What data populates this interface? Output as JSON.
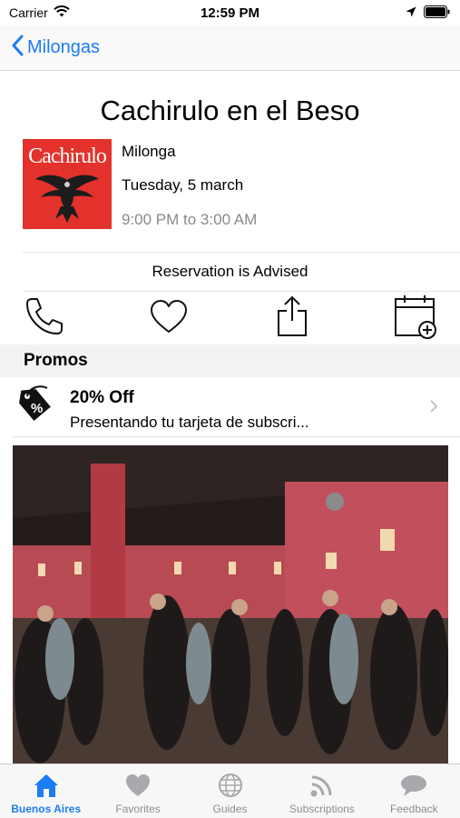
{
  "status_bar": {
    "carrier": "Carrier",
    "time": "12:59 PM"
  },
  "nav": {
    "back_label": "Milongas"
  },
  "event": {
    "title": "Cachirulo en el Beso",
    "logo_text": "Cachirulo",
    "type": "Milonga",
    "date": "Tuesday, 5 march",
    "time": "9:00 PM to 3:00 AM",
    "reservation": "Reservation is Advised"
  },
  "actions": [
    {
      "name": "call",
      "icon": "phone-icon"
    },
    {
      "name": "favorite",
      "icon": "heart-icon"
    },
    {
      "name": "share",
      "icon": "share-icon"
    },
    {
      "name": "add-to-calendar",
      "icon": "calendar-add-icon"
    }
  ],
  "promos": {
    "header": "Promos",
    "items": [
      {
        "title": "20% Off",
        "description": "Presentando tu tarjeta de subscri...",
        "icon": "percent-tag-icon"
      }
    ]
  },
  "tabs": [
    {
      "label": "Buenos Aires",
      "icon": "house-icon",
      "active": true
    },
    {
      "label": "Favorites",
      "icon": "heart-icon",
      "active": false
    },
    {
      "label": "Guides",
      "icon": "globe-icon",
      "active": false
    },
    {
      "label": "Subscriptions",
      "icon": "feed-icon",
      "active": false
    },
    {
      "label": "Feedback",
      "icon": "speech-bubble-icon",
      "active": false
    }
  ],
  "colors": {
    "accent": "#1c7cf4",
    "logo_red": "#e3322b",
    "inactive": "#8e8e93"
  }
}
